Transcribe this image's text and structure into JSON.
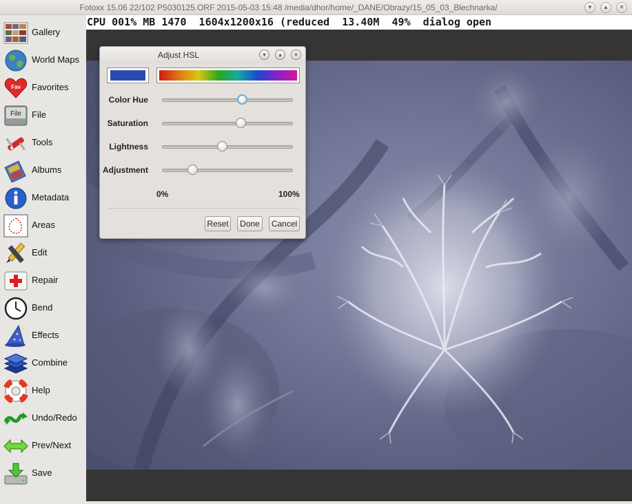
{
  "window": {
    "title": "Fotoxx 15.06  22/102  P5030125.ORF  2015-05-03 15:48  /media/dhor/home/_DANE/Obrazy/15_05_03_Blechnarka/"
  },
  "status": {
    "text": "CPU 001% MB 1470  1604x1200x16 (reduced  13.40M  49%  dialog open"
  },
  "sidebar": {
    "items": [
      {
        "label": "Gallery"
      },
      {
        "label": "World Maps"
      },
      {
        "label": "Favorites"
      },
      {
        "label": "File"
      },
      {
        "label": "Tools"
      },
      {
        "label": "Albums"
      },
      {
        "label": "Metadata"
      },
      {
        "label": "Areas"
      },
      {
        "label": "Edit"
      },
      {
        "label": "Repair"
      },
      {
        "label": "Bend"
      },
      {
        "label": "Effects"
      },
      {
        "label": "Combine"
      },
      {
        "label": "Help"
      },
      {
        "label": "Undo/Redo"
      },
      {
        "label": "Prev/Next"
      },
      {
        "label": "Save"
      }
    ]
  },
  "icons": {
    "favorites_badge": "Fav",
    "file_badge": "File"
  },
  "dialog": {
    "title": "Adjust HSL",
    "selected_color": "#2a4bb0",
    "sliders": [
      {
        "label": "Color Hue",
        "value": 0.61
      },
      {
        "label": "Saturation",
        "value": 0.6
      },
      {
        "label": "Lightness",
        "value": 0.46
      },
      {
        "label": "Adjustment",
        "value": 0.23
      }
    ],
    "scale_min": "0%",
    "scale_max": "100%",
    "buttons": {
      "reset": "Reset",
      "done": "Done",
      "cancel": "Cancel"
    }
  }
}
